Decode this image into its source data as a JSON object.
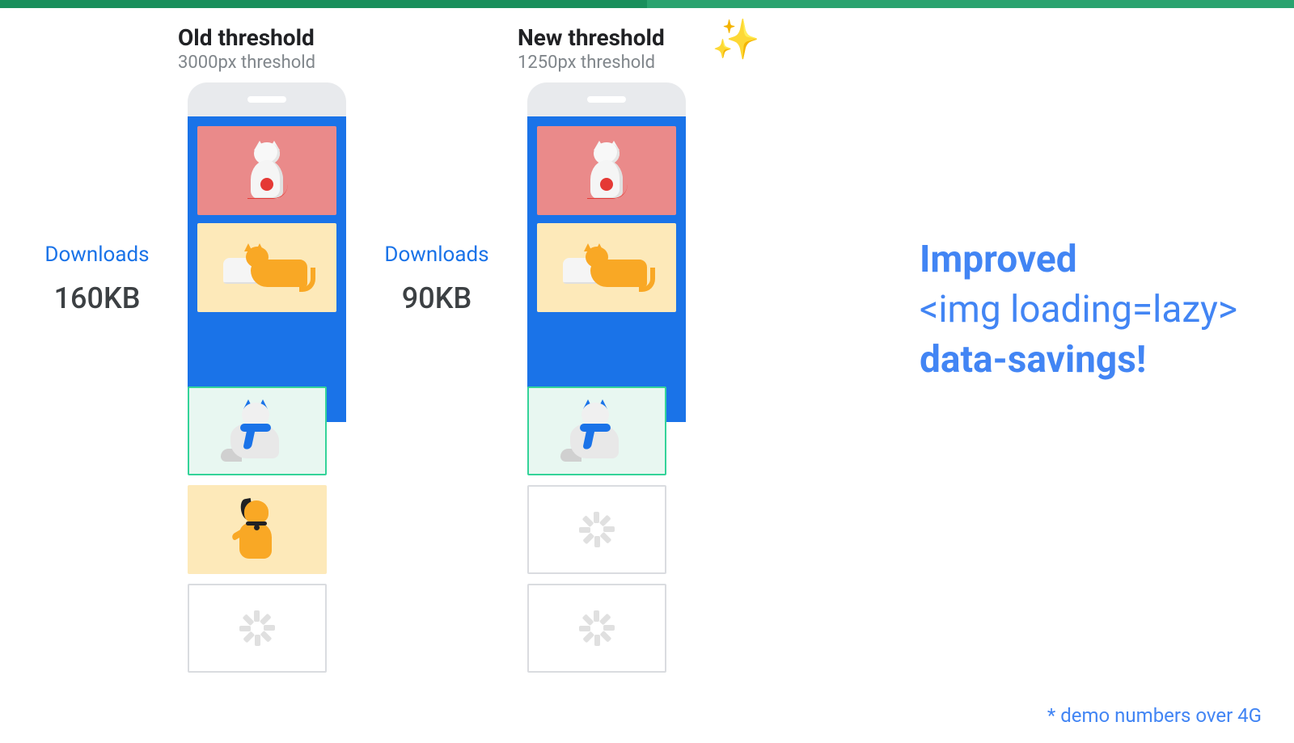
{
  "columns": {
    "old": {
      "title": "Old threshold",
      "subtitle": "3000px threshold",
      "downloads_label": "Downloads",
      "downloads_value": "160KB",
      "loaded_images": 4,
      "placeholders_below": 1
    },
    "new": {
      "title": "New threshold",
      "subtitle": "1250px threshold",
      "downloads_label": "Downloads",
      "downloads_value": "90KB",
      "loaded_images": 3,
      "placeholders_below": 2
    }
  },
  "message": {
    "line1_bold": "Improved",
    "line2": "<img loading=lazy>",
    "line3_bold": "data-savings!"
  },
  "disclaimer": "* demo numbers over 4G",
  "icons": {
    "sparkle": "✨"
  }
}
